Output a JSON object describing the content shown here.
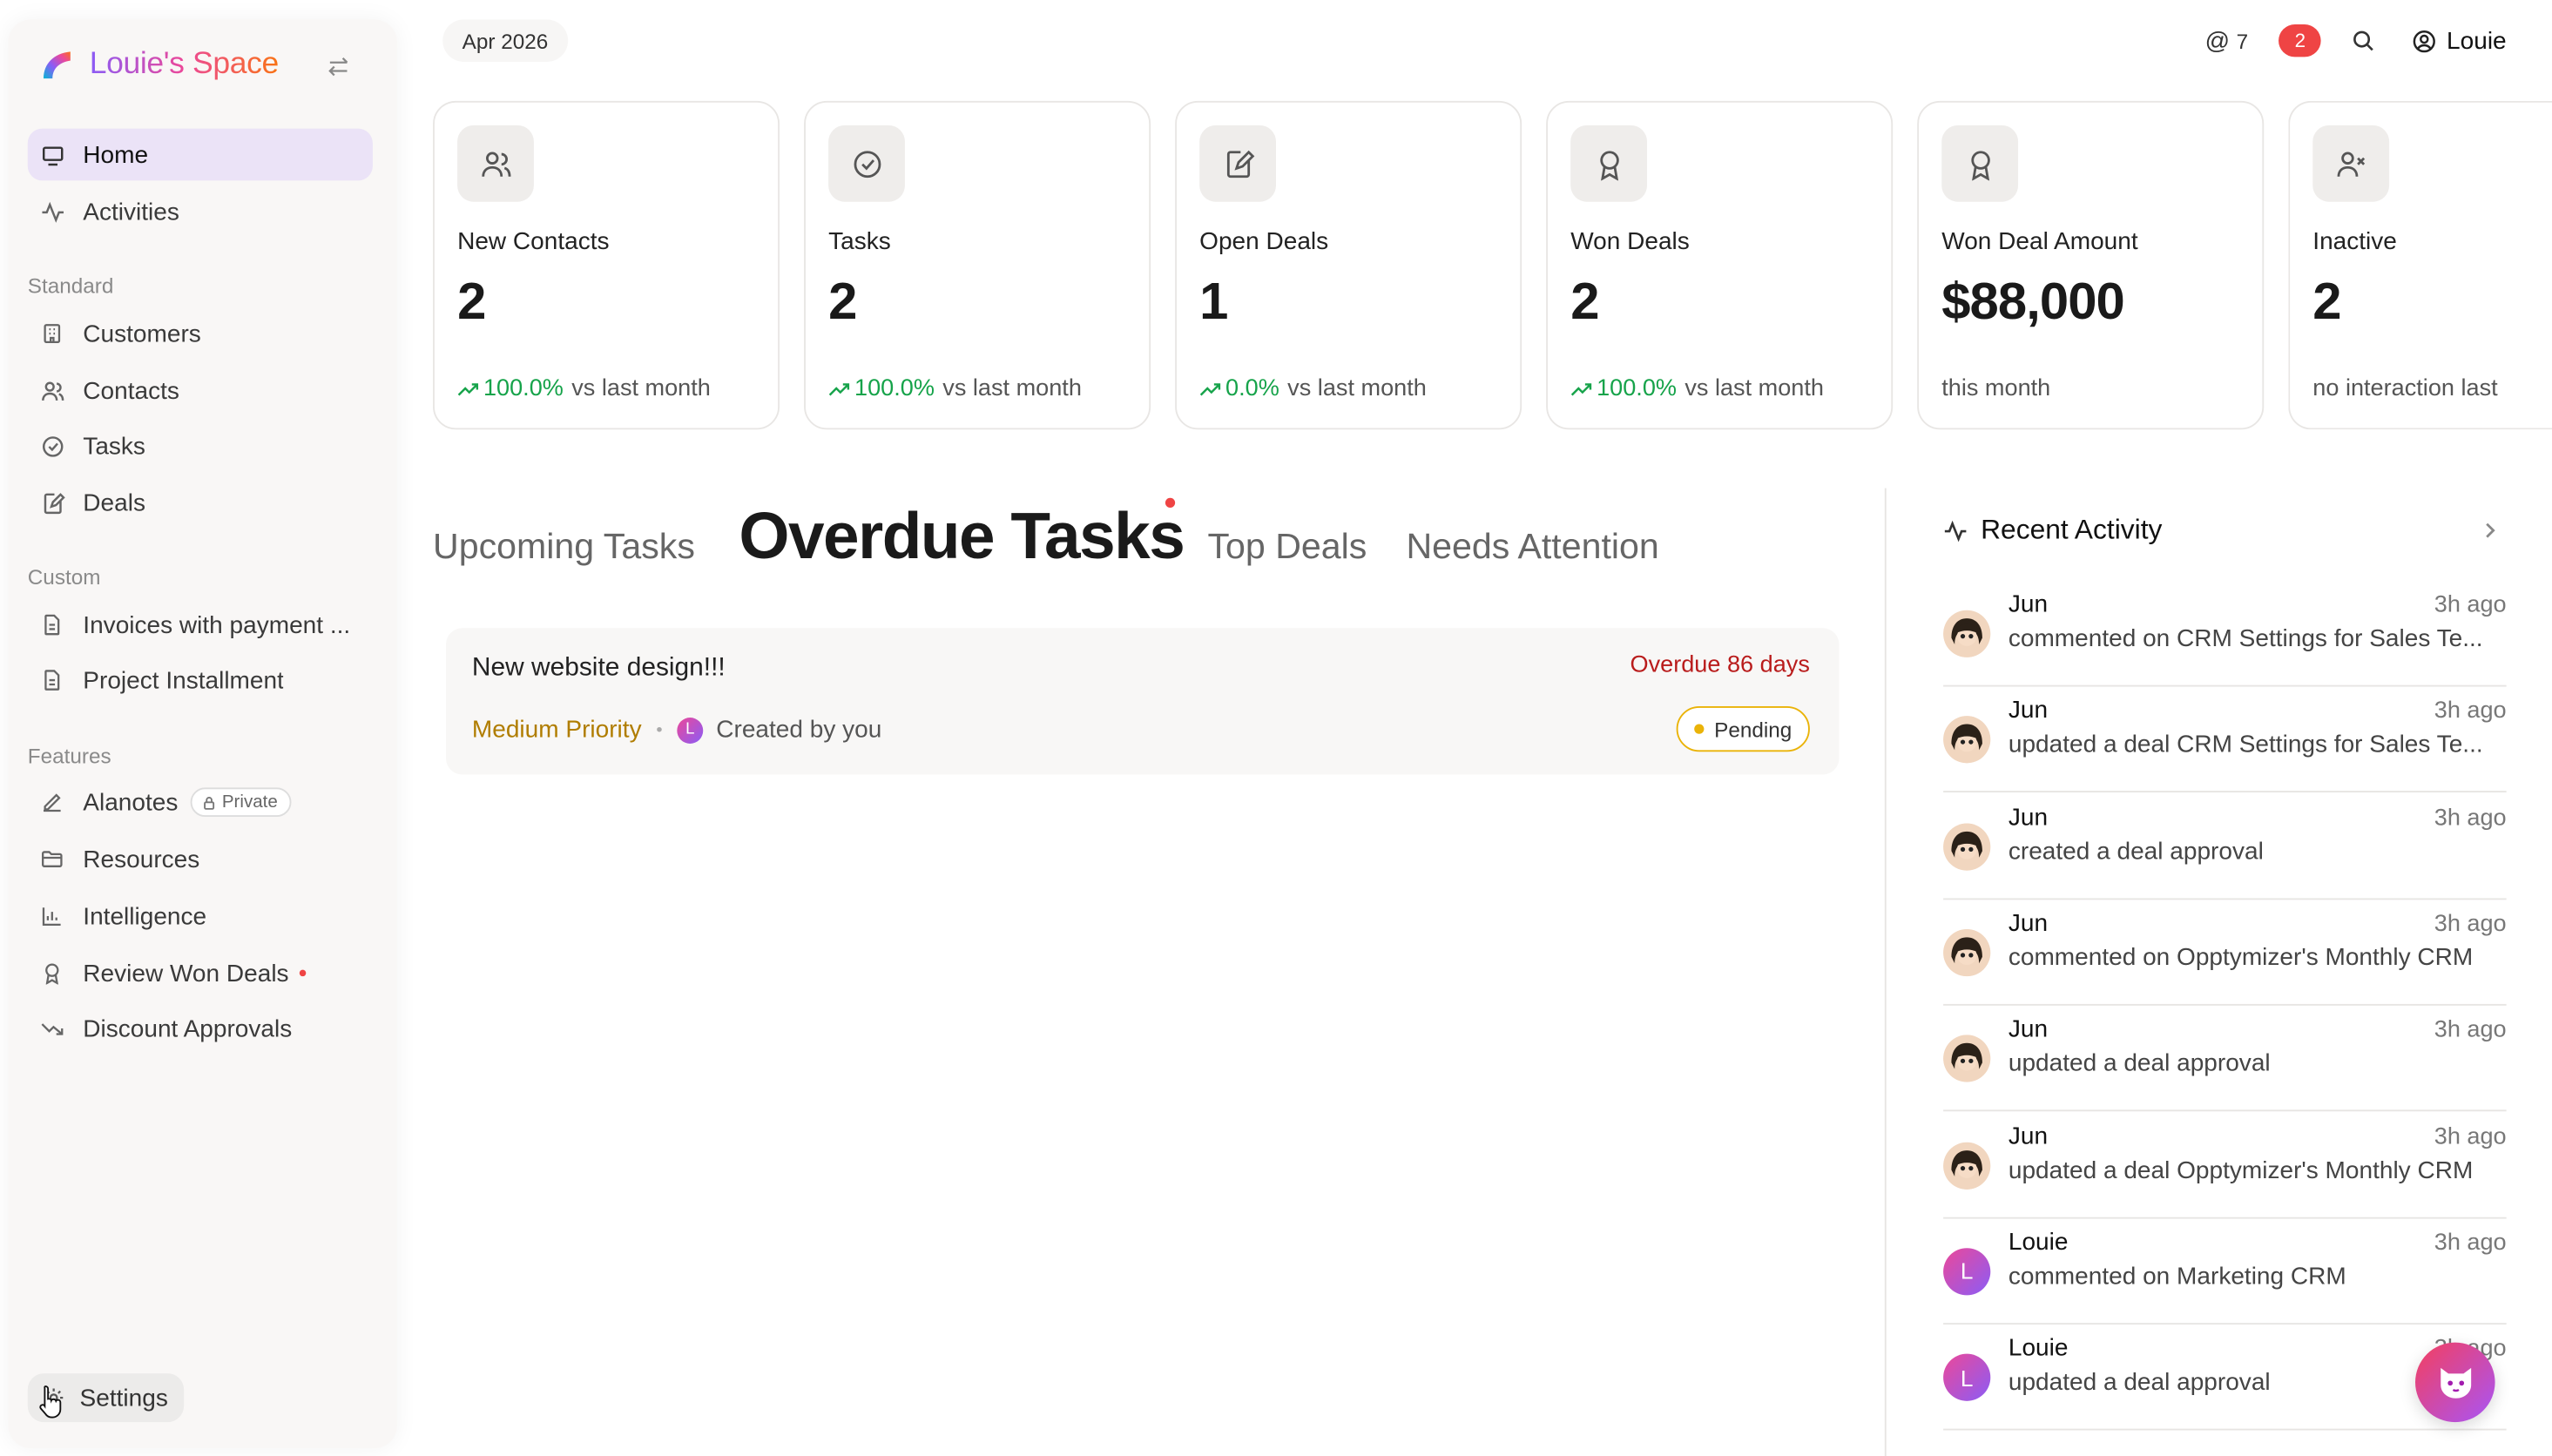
{
  "sidebar": {
    "brand": "Louie's Space",
    "home": "Home",
    "activities": "Activities",
    "standard_heading": "Standard",
    "customers": "Customers",
    "contacts": "Contacts",
    "tasks": "Tasks",
    "deals": "Deals",
    "custom_heading": "Custom",
    "invoices": "Invoices with payment ...",
    "project_installment": "Project Installment",
    "features_heading": "Features",
    "alanotes": "Alanotes",
    "private_badge": "Private",
    "resources": "Resources",
    "intelligence": "Intelligence",
    "review_won_deals": "Review Won Deals",
    "discount_approvals": "Discount Approvals",
    "settings": "Settings"
  },
  "topbar": {
    "date": "Apr 2026",
    "mentions": "7",
    "notifications": "2",
    "user": "Louie"
  },
  "stats": [
    {
      "title": "New Contacts",
      "value": "2",
      "change": "100.0%",
      "suffix": "vs last month"
    },
    {
      "title": "Tasks",
      "value": "2",
      "change": "100.0%",
      "suffix": "vs last month"
    },
    {
      "title": "Open Deals",
      "value": "1",
      "change": "0.0%",
      "suffix": "vs last month"
    },
    {
      "title": "Won Deals",
      "value": "2",
      "change": "100.0%",
      "suffix": "vs last month"
    },
    {
      "title": "Won Deal Amount",
      "value": "$88,000",
      "footer": "this month"
    },
    {
      "title": "Inactive",
      "value": "2",
      "footer": "no interaction last"
    }
  ],
  "tabs": {
    "upcoming": "Upcoming Tasks",
    "overdue": "Overdue Tasks",
    "top_deals": "Top Deals",
    "needs_attention": "Needs Attention"
  },
  "task": {
    "title": "New website design!!!",
    "overdue": "Overdue 86 days",
    "priority": "Medium Priority",
    "separator": "•",
    "creator_initial": "L",
    "created_by": "Created by you",
    "status": "Pending"
  },
  "activity": {
    "heading": "Recent Activity",
    "items": [
      {
        "name": "Jun",
        "time": "3h ago",
        "text": "commented on CRM Settings for Sales Te..."
      },
      {
        "name": "Jun",
        "time": "3h ago",
        "text": "updated a deal CRM Settings for Sales Te..."
      },
      {
        "name": "Jun",
        "time": "3h ago",
        "text": "created a deal approval"
      },
      {
        "name": "Jun",
        "time": "3h ago",
        "text": "commented on Opptymizer's Monthly CRM"
      },
      {
        "name": "Jun",
        "time": "3h ago",
        "text": "updated a deal approval"
      },
      {
        "name": "Jun",
        "time": "3h ago",
        "text": "updated a deal Opptymizer's Monthly CRM"
      },
      {
        "name": "Louie",
        "time": "3h ago",
        "text": "commented on Marketing CRM",
        "initial": "L"
      },
      {
        "name": "Louie",
        "time": "3h ago",
        "text": "updated a deal approval",
        "initial": "L"
      }
    ]
  },
  "colors": {
    "accent": "#ebe3f7",
    "positive": "#16a34a",
    "overdue": "#b91c1c",
    "notification": "#ef4444",
    "pending": "#eab308"
  }
}
